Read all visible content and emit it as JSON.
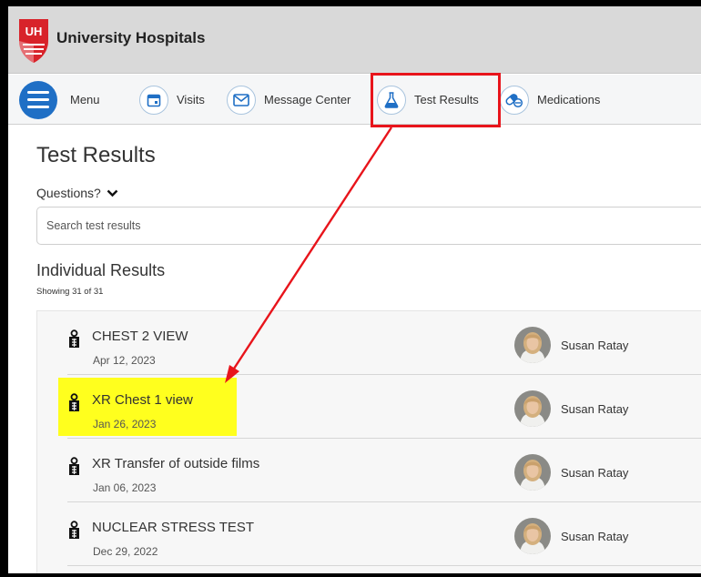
{
  "header": {
    "brand": "University Hospitals",
    "logo_letters": "UH"
  },
  "nav": {
    "items": [
      {
        "label": "Menu",
        "icon": "hamburger-icon"
      },
      {
        "label": "Visits",
        "icon": "calendar-icon"
      },
      {
        "label": "Message Center",
        "icon": "envelope-icon"
      },
      {
        "label": "Test Results",
        "icon": "flask-icon"
      },
      {
        "label": "Medications",
        "icon": "pills-icon"
      }
    ]
  },
  "main": {
    "title": "Test Results",
    "questions_label": "Questions?",
    "search_placeholder": "Search test results",
    "results_heading": "Individual Results",
    "results_count": "Showing 31 of 31"
  },
  "results": [
    {
      "name": "CHEST 2 VIEW",
      "date": "Apr 12, 2023",
      "provider": "Susan Ratay",
      "highlighted": false
    },
    {
      "name": "XR Chest 1 view",
      "date": "Jan 26, 2023",
      "provider": "Susan Ratay",
      "highlighted": true
    },
    {
      "name": "XR Transfer of outside films",
      "date": "Jan 06, 2023",
      "provider": "Susan Ratay",
      "highlighted": false
    },
    {
      "name": "NUCLEAR STRESS TEST",
      "date": "Dec 29, 2022",
      "provider": "Susan Ratay",
      "highlighted": false
    }
  ],
  "colors": {
    "annotation_red": "#e8141b",
    "highlight_yellow": "#ffff1e",
    "menu_blue": "#1f6fc5",
    "logo_red": "#d8232a"
  }
}
